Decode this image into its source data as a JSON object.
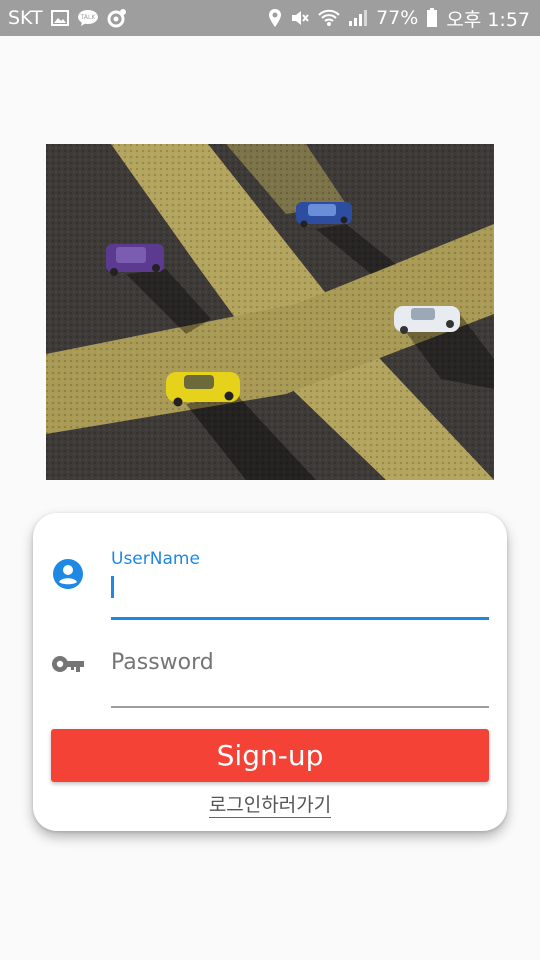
{
  "status_bar": {
    "carrier": "SKT",
    "battery": "77%",
    "time": "오후 1:57",
    "background": "#9e9e9e",
    "left_icons": [
      "image-icon",
      "talk-icon",
      "circle-app-icon"
    ],
    "right_icons": [
      "location-icon",
      "mute-icon",
      "wifi-icon",
      "signal-icon",
      "battery-icon"
    ]
  },
  "hero_image": {
    "description_icon": "toy-cars-on-road-image"
  },
  "form": {
    "username": {
      "label": "UserName",
      "value": "",
      "icon": "account-circle-icon",
      "focused": true
    },
    "password": {
      "placeholder": "Password",
      "value": "",
      "icon": "key-icon"
    },
    "signup_label": "Sign-up",
    "login_link": "로그인하러가기"
  },
  "colors": {
    "accent": "#1e88e5",
    "button": "#f44336",
    "background": "#fafafa"
  }
}
